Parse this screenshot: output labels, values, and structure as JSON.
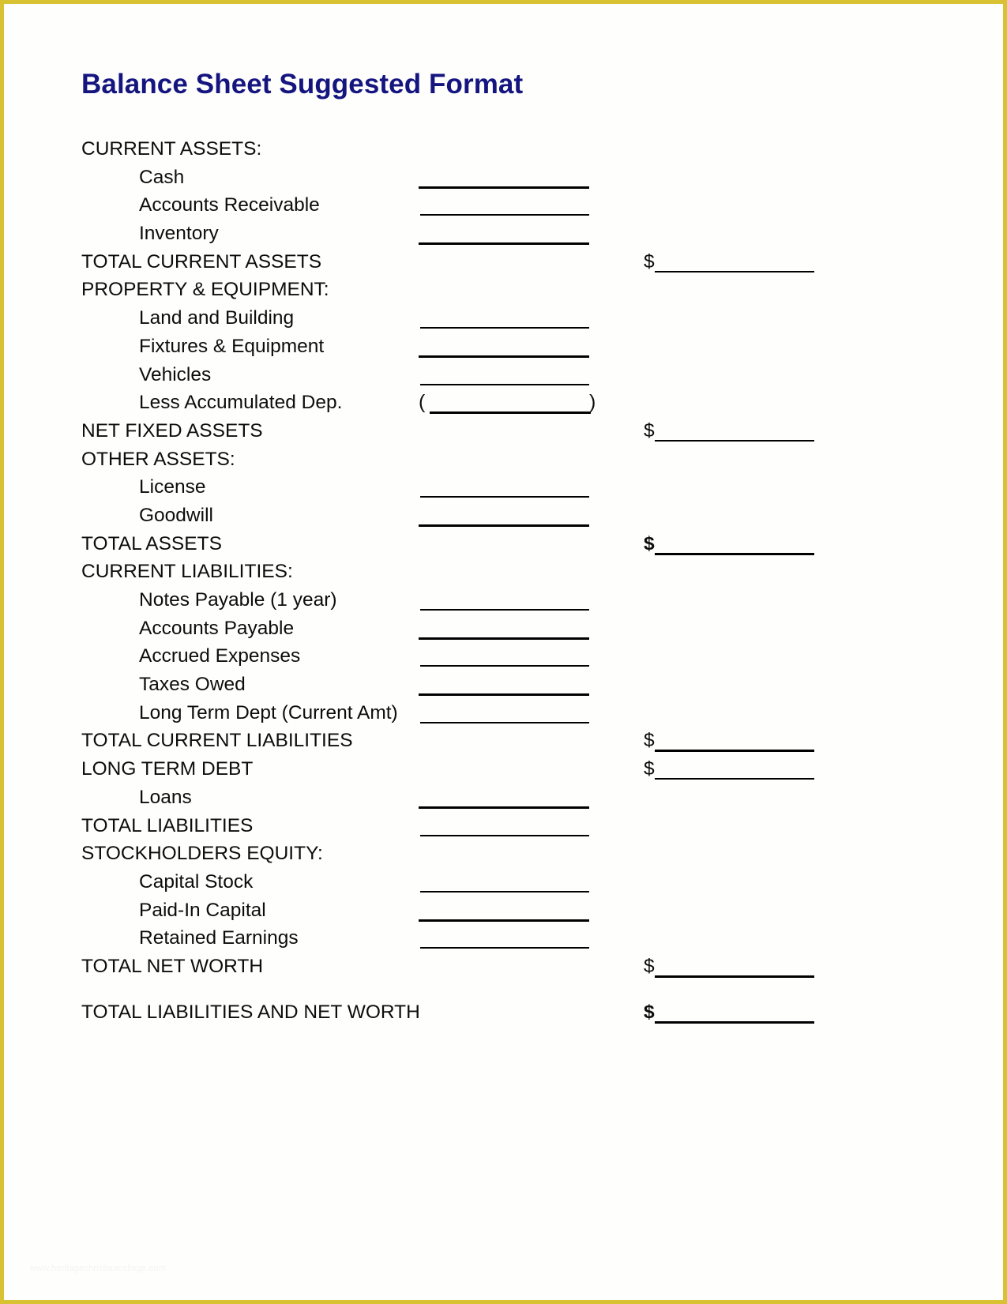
{
  "document": {
    "title": "Balance Sheet Suggested Format",
    "title_color": "#151580",
    "border_color": "#d9c134",
    "page_background": "#fefefd",
    "rule_color": "#000000",
    "currency_symbol": "$",
    "paren_open": "(",
    "paren_close": ")",
    "watermark": "www.heritagechristiancollege.com"
  },
  "rows": [
    {
      "label": "CURRENT ASSETS:",
      "indent": false,
      "kind": "heading"
    },
    {
      "label": "Cash",
      "indent": true,
      "kind": "blank-mid",
      "rule": "thick"
    },
    {
      "label": "Accounts Receivable",
      "indent": true,
      "kind": "blank-mid",
      "rule": "thin"
    },
    {
      "label": "Inventory",
      "indent": true,
      "kind": "blank-mid",
      "rule": "thick"
    },
    {
      "label": "TOTAL CURRENT ASSETS",
      "indent": false,
      "kind": "total",
      "rule": "thin",
      "bold": false
    },
    {
      "label": "PROPERTY & EQUIPMENT:",
      "indent": false,
      "kind": "heading"
    },
    {
      "label": "Land and Building",
      "indent": true,
      "kind": "blank-mid",
      "rule": "thin"
    },
    {
      "label": "Fixtures & Equipment",
      "indent": true,
      "kind": "blank-mid",
      "rule": "thick"
    },
    {
      "label": "Vehicles",
      "indent": true,
      "kind": "blank-mid",
      "rule": "thin"
    },
    {
      "label": "Less Accumulated Dep.",
      "indent": true,
      "kind": "blank-paren"
    },
    {
      "label": "NET FIXED ASSETS",
      "indent": false,
      "kind": "total",
      "rule": "thin",
      "bold": false
    },
    {
      "label": "OTHER ASSETS:",
      "indent": false,
      "kind": "heading"
    },
    {
      "label": "License",
      "indent": true,
      "kind": "blank-mid",
      "rule": "thin"
    },
    {
      "label": "Goodwill",
      "indent": true,
      "kind": "blank-mid",
      "rule": "thick"
    },
    {
      "label": "TOTAL ASSETS",
      "indent": false,
      "kind": "total",
      "rule": "thick",
      "bold": true
    },
    {
      "label": "CURRENT LIABILITIES:",
      "indent": false,
      "kind": "heading"
    },
    {
      "label": "Notes Payable (1 year)",
      "indent": true,
      "kind": "blank-mid",
      "rule": "thin"
    },
    {
      "label": "Accounts Payable",
      "indent": true,
      "kind": "blank-mid",
      "rule": "thick"
    },
    {
      "label": "Accrued Expenses",
      "indent": true,
      "kind": "blank-mid",
      "rule": "thin"
    },
    {
      "label": "Taxes Owed",
      "indent": true,
      "kind": "blank-mid",
      "rule": "thick"
    },
    {
      "label": "Long Term Dept (Current Amt)",
      "indent": true,
      "kind": "blank-mid",
      "rule": "thin"
    },
    {
      "label": "TOTAL CURRENT LIABILITIES",
      "indent": false,
      "kind": "total",
      "rule": "thick",
      "bold": false
    },
    {
      "label": "LONG TERM DEBT",
      "indent": false,
      "kind": "total",
      "rule": "thin",
      "bold": false
    },
    {
      "label": "Loans",
      "indent": true,
      "kind": "blank-mid",
      "rule": "thick"
    },
    {
      "label": "TOTAL LIABILITIES",
      "indent": false,
      "kind": "blank-mid",
      "rule": "thin"
    },
    {
      "label": "STOCKHOLDERS EQUITY:",
      "indent": false,
      "kind": "heading"
    },
    {
      "label": "Capital Stock",
      "indent": true,
      "kind": "blank-mid",
      "rule": "thin"
    },
    {
      "label": "Paid-In Capital",
      "indent": true,
      "kind": "blank-mid",
      "rule": "thick"
    },
    {
      "label": "Retained Earnings",
      "indent": true,
      "kind": "blank-mid",
      "rule": "thin"
    },
    {
      "label": "TOTAL NET WORTH",
      "indent": false,
      "kind": "total",
      "rule": "thick",
      "bold": false
    },
    {
      "label": "TOTAL LIABILITIES AND NET WORTH",
      "indent": false,
      "kind": "total",
      "rule": "thick",
      "bold": true,
      "gap_before": true
    }
  ]
}
